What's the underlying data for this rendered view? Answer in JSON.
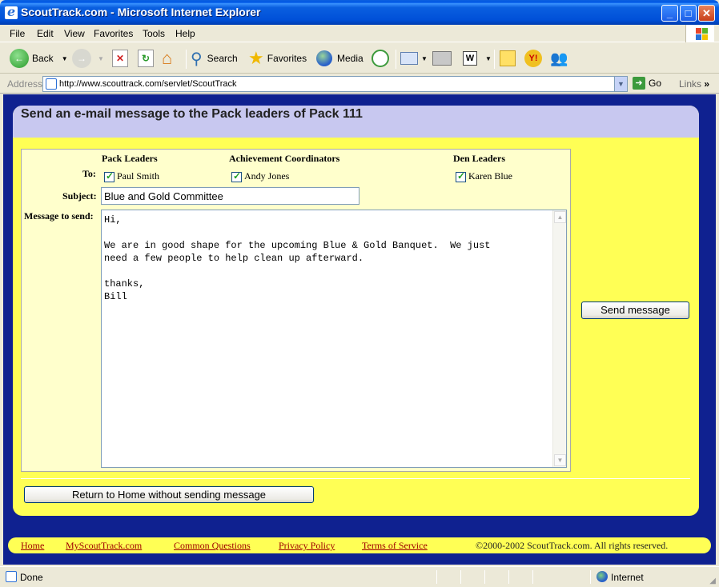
{
  "window": {
    "title": "ScoutTrack.com - Microsoft Internet Explorer"
  },
  "menubar": [
    "File",
    "Edit",
    "View",
    "Favorites",
    "Tools",
    "Help"
  ],
  "toolbar": {
    "back": "Back",
    "search": "Search",
    "favorites": "Favorites",
    "media": "Media"
  },
  "address": {
    "label": "Address",
    "url": "http://www.scouttrack.com/servlet/ScoutTrack",
    "go": "Go",
    "links": "Links"
  },
  "page": {
    "heading": "Send an e-mail message to the Pack leaders of Pack 111",
    "groups": {
      "pack_leaders": "Pack Leaders",
      "achievement_coordinators": "Achievement Coordinators",
      "den_leaders": "Den Leaders"
    },
    "labels": {
      "to": "To:",
      "subject": "Subject:",
      "message": "Message to send:"
    },
    "recipients": [
      {
        "name": "Paul Smith",
        "checked": true
      },
      {
        "name": "Andy Jones",
        "checked": true
      },
      {
        "name": "Karen Blue",
        "checked": true
      }
    ],
    "subject_value": "Blue and Gold Committee",
    "message_value": "Hi,\n\nWe are in good shape for the upcoming Blue & Gold Banquet.  We just\nneed a few people to help clean up afterward.\n\nthanks,\nBill",
    "send_button": "Send message",
    "return_button": "Return to Home without sending message"
  },
  "footer": {
    "links": [
      "Home",
      "MyScoutTrack.com",
      "Common Questions",
      "Privacy Policy",
      "Terms of Service"
    ],
    "copyright": "©2000-2002 ScoutTrack.com. All rights reserved."
  },
  "status": {
    "text": "Done",
    "zone": "Internet"
  },
  "colors": {
    "page_bg": "#0f2190",
    "panel": "#ffff55",
    "header": "#c8c8f0",
    "form": "#ffffcc"
  }
}
